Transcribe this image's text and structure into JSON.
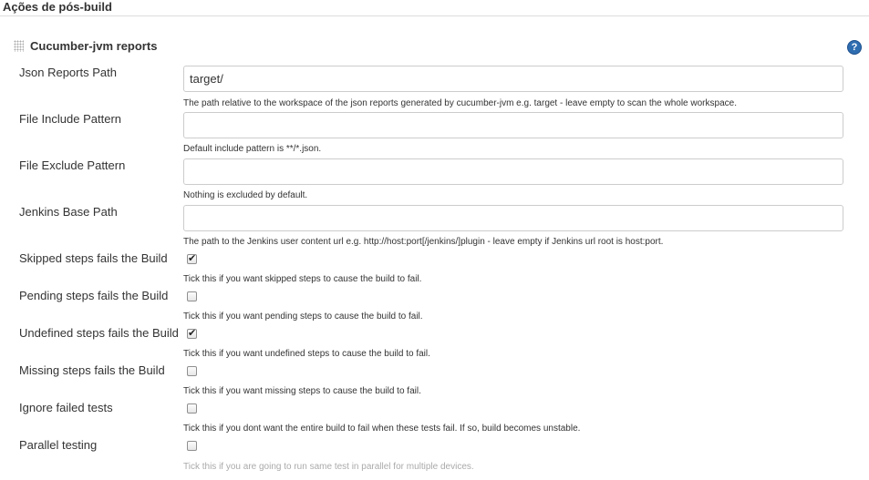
{
  "section": {
    "title": "Ações de pós-build"
  },
  "block": {
    "title": "Cucumber-jvm reports",
    "help_glyph": "?"
  },
  "fields": {
    "json_reports_path": {
      "label": "Json Reports Path",
      "value": "target/",
      "description": "The path relative to the workspace of the json reports generated by cucumber-jvm e.g. target - leave empty to scan the whole workspace."
    },
    "file_include_pattern": {
      "label": "File Include Pattern",
      "value": "",
      "description": "Default include pattern is **/*.json."
    },
    "file_exclude_pattern": {
      "label": "File Exclude Pattern",
      "value": "",
      "description": "Nothing is excluded by default."
    },
    "jenkins_base_path": {
      "label": "Jenkins Base Path",
      "value": "",
      "description": "The path to the Jenkins user content url e.g. http://host:port[/jenkins/]plugin - leave empty if Jenkins url root is host:port."
    }
  },
  "checkboxes": {
    "skipped": {
      "label": "Skipped steps fails the Build",
      "checked": true,
      "description": "Tick this if you want skipped steps to cause the build to fail."
    },
    "pending": {
      "label": "Pending steps fails the Build",
      "checked": false,
      "description": "Tick this if you want pending steps to cause the build to fail."
    },
    "undefined": {
      "label": "Undefined steps fails the Build",
      "checked": true,
      "description": "Tick this if you want undefined steps to cause the build to fail."
    },
    "missing": {
      "label": "Missing steps fails the Build",
      "checked": false,
      "description": "Tick this if you want missing steps to cause the build to fail."
    },
    "ignore_failed": {
      "label": "Ignore failed tests",
      "checked": false,
      "description": "Tick this if you dont want the entire build to fail when these tests fail. If so, build becomes unstable."
    },
    "parallel": {
      "label": "Parallel testing",
      "checked": false,
      "description": "Tick this if you are going to run same test in parallel for multiple devices."
    }
  },
  "colors": {
    "help_icon": "#2f6db1",
    "border": "#cccccc",
    "text": "#333333"
  },
  "icons": {
    "drag_handle": "grip-icon",
    "help": "help-icon",
    "check": "checkmark-icon"
  }
}
